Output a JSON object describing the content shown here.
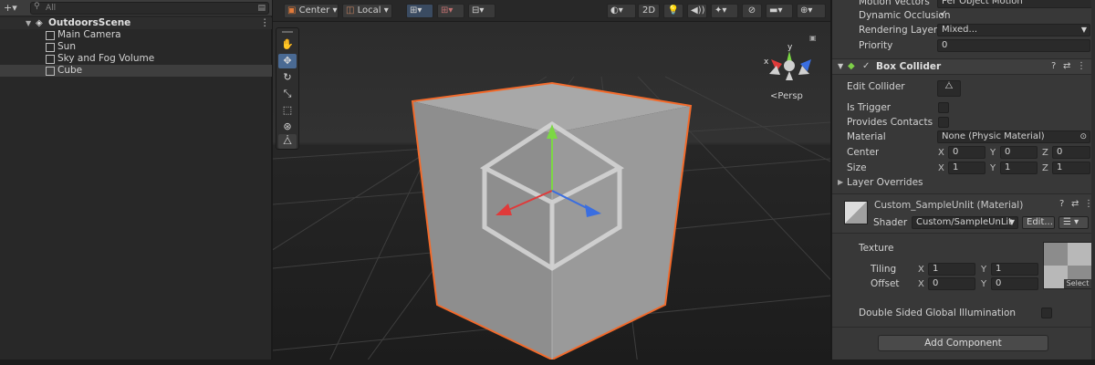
{
  "hierarchy": {
    "add_label": "+▾",
    "search_placeholder": "All",
    "scene_name": "OutdoorsScene",
    "menu_label": "⋮",
    "items": [
      {
        "label": "Main Camera"
      },
      {
        "label": "Sun"
      },
      {
        "label": "Sky and Fog Volume"
      },
      {
        "label": "Cube"
      }
    ]
  },
  "scene_toolbar": {
    "pivot_label": "Center",
    "space_label": "Local",
    "mode_2d_label": "2D"
  },
  "scene_view": {
    "projection_label": "Persp",
    "gizmo_y_label": "y",
    "gizmo_x_label": "x"
  },
  "inspector": {
    "motion_vectors_label": "Motion Vectors",
    "motion_vectors_value": "Per Object Motion",
    "dynamic_occlusion_label": "Dynamic Occlusion",
    "dynamic_occlusion_checked": "✓",
    "rendering_layer_label": "Rendering Layer M",
    "rendering_layer_value": "Mixed...",
    "priority_label": "Priority",
    "priority_value": "0",
    "box_collider": {
      "title": "Box Collider",
      "enabled_mark": "✓",
      "edit_collider_label": "Edit Collider",
      "is_trigger_label": "Is Trigger",
      "provides_contacts_label": "Provides Contacts",
      "material_label": "Material",
      "material_value": "None (Physic Material)",
      "center_label": "Center",
      "center": {
        "x": "0",
        "y": "0",
        "z": "0"
      },
      "size_label": "Size",
      "size": {
        "x": "1",
        "y": "1",
        "z": "1"
      },
      "layer_overrides_label": "Layer Overrides",
      "axis_x": "X",
      "axis_y": "Y",
      "axis_z": "Z"
    },
    "material": {
      "title": "Custom_SampleUnlit (Material)",
      "shader_label": "Shader",
      "shader_value": "Custom/SampleUnLit",
      "edit_label": "Edit...",
      "texture_label": "Texture",
      "tiling_label": "Tiling",
      "tiling": {
        "x": "1",
        "y": "1"
      },
      "offset_label": "Offset",
      "offset": {
        "x": "0",
        "y": "0"
      },
      "select_label": "Select",
      "double_sided_label": "Double Sided Global Illumination"
    },
    "add_component_label": "Add Component"
  },
  "colors": {
    "accent_blue": "#4a6a93",
    "selection_outline": "#f26a2b",
    "gizmo_x": "#e03a3a",
    "gizmo_y": "#7cd844",
    "gizmo_z": "#3a6ee0"
  }
}
